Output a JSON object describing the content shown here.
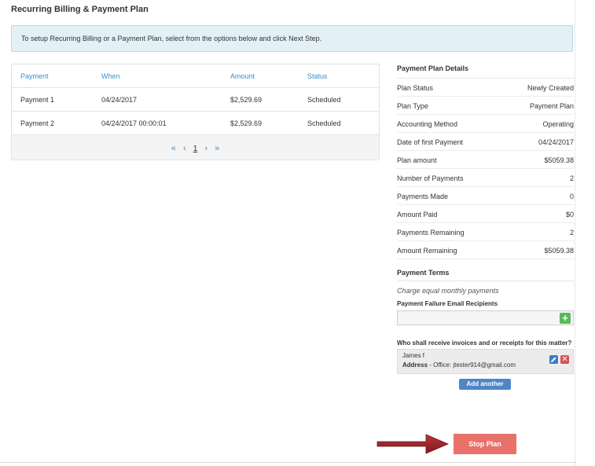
{
  "page_title": "Recurring Billing & Payment Plan",
  "info_text": "To setup Recurring Billing or a Payment Plan, select from the options below and click Next Step.",
  "table": {
    "headers": [
      "Payment",
      "When",
      "Amount",
      "Status"
    ],
    "rows": [
      {
        "payment": "Payment 1",
        "when": "04/24/2017",
        "amount": "$2,529.69",
        "status": "Scheduled"
      },
      {
        "payment": "Payment 2",
        "when": "04/24/2017 00:00:01",
        "amount": "$2,529.69",
        "status": "Scheduled"
      }
    ],
    "pager": {
      "first": "«",
      "prev": "‹",
      "page": "1",
      "next": "›",
      "last": "»"
    }
  },
  "details": {
    "title": "Payment Plan Details",
    "rows": [
      {
        "label": "Plan Status",
        "value": "Newly Created"
      },
      {
        "label": "Plan Type",
        "value": "Payment Plan"
      },
      {
        "label": "Accounting Method",
        "value": "Operating"
      },
      {
        "label": "Date of first Payment",
        "value": "04/24/2017"
      },
      {
        "label": "Plan amount",
        "value": "$5059.38"
      },
      {
        "label": "Number of Payments",
        "value": "2"
      },
      {
        "label": "Payments Made",
        "value": "0"
      },
      {
        "label": "Amount Paid",
        "value": "$0"
      },
      {
        "label": "Payments Remaining",
        "value": "2"
      },
      {
        "label": "Amount Remaining",
        "value": "$5059.38"
      }
    ]
  },
  "terms": {
    "title": "Payment Terms",
    "text": "Charge equal monthly payments",
    "failure_label": "Payment Failure Email Recipients",
    "failure_value": "",
    "add_icon": "+"
  },
  "recipients": {
    "label": "Who shall receive invoices and or receipts for this matter?",
    "name": "James f",
    "address_label": "Address",
    "address_value": " - Office: jtester914@gmail.com",
    "delete_icon": "✕",
    "add_another": "Add another"
  },
  "stop_button": "Stop Plan",
  "colors": {
    "accent": "#3a8fc7",
    "stop": "#e8726a",
    "arrow": "#9b2226",
    "add_green": "#5cb85c",
    "delete_red": "#d9534f"
  }
}
